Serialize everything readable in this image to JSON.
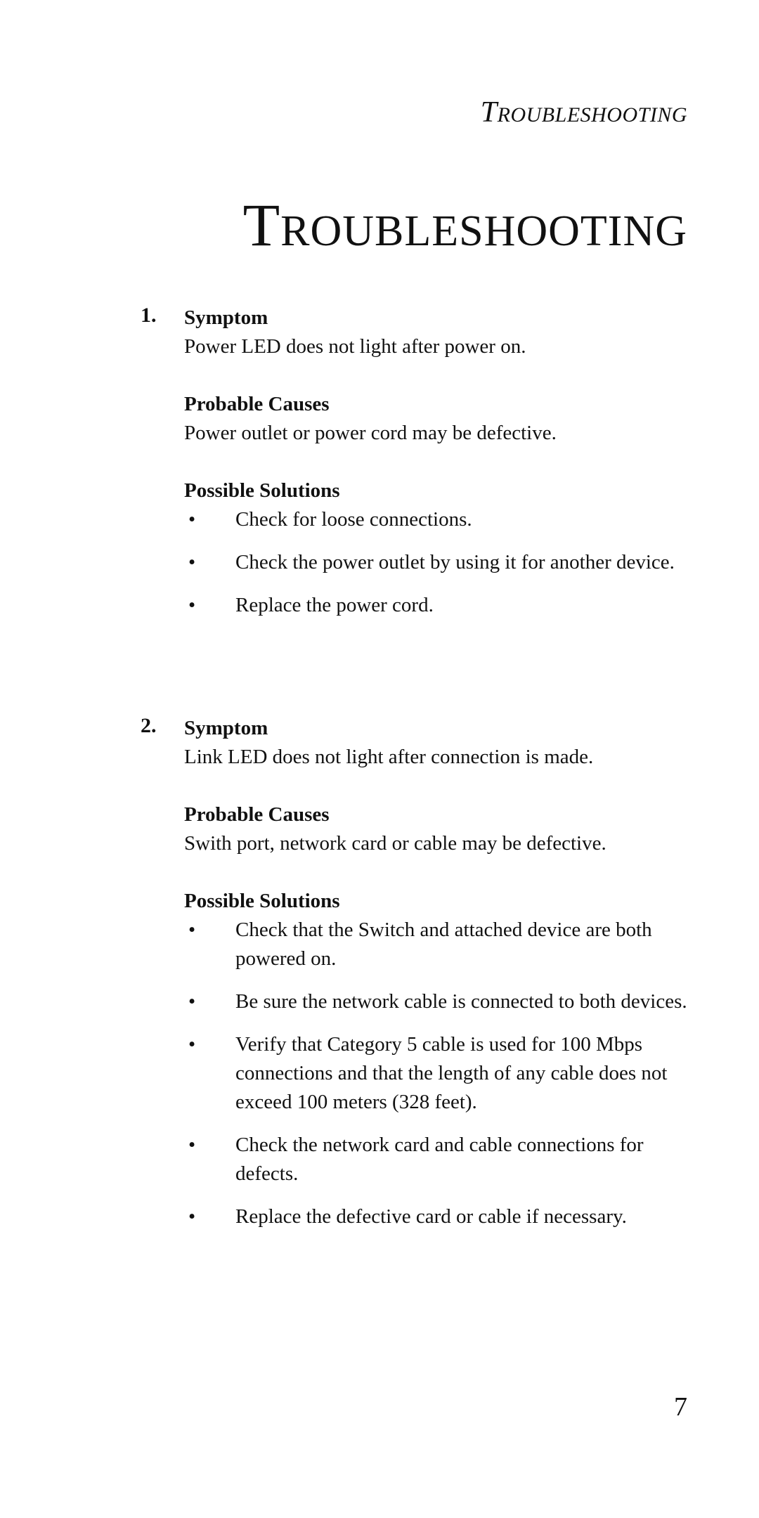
{
  "header": {
    "running_title_first": "T",
    "running_title_rest": "ROUBLESHOOTING"
  },
  "title": {
    "first": "T",
    "rest": "ROUBLESHOOTING"
  },
  "sections": [
    {
      "number": "1.",
      "symptom_label": "Symptom",
      "symptom": "Power LED does not light after power on.",
      "causes_label": "Probable Causes",
      "causes": "Power outlet or power cord may be defective.",
      "solutions_label": "Possible Solutions",
      "solutions": [
        "Check for loose connections.",
        "Check the power outlet by using it for another device.",
        "Replace the power cord."
      ]
    },
    {
      "number": "2.",
      "symptom_label": "Symptom",
      "symptom": "Link LED does not light after connection is made.",
      "causes_label": "Probable Causes",
      "causes": "Swith port, network card or cable may be defective.",
      "solutions_label": "Possible Solutions",
      "solutions": [
        "Check that the Switch and attached device are both powered on.",
        "Be sure the network cable is connected to both devices.",
        "Verify that Category 5 cable is used for 100 Mbps connections and that the length of any cable does not exceed 100 meters (328 feet).",
        "Check the network card and cable connections for defects.",
        "Replace the defective card or cable if necessary."
      ]
    }
  ],
  "bullet_glyph": "•",
  "page_number": "7"
}
